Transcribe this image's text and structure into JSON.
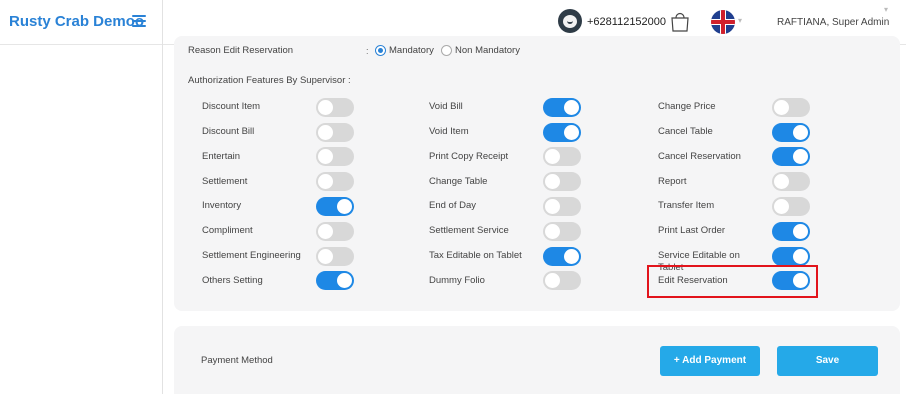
{
  "header": {
    "brand": "Rusty Crab Demoo",
    "phone": "+628112152000",
    "user": "RAFTIANA, Super Admin",
    "icons": [
      "menu-icon",
      "support-icon",
      "shopping-bag-icon",
      "uk-flag-icon"
    ]
  },
  "reason_edit": {
    "label": "Reason Edit Reservation",
    "colon": ":",
    "options": [
      {
        "label": "Mandatory",
        "selected": true
      },
      {
        "label": "Non Mandatory",
        "selected": false
      }
    ]
  },
  "auth": {
    "title": "Authorization Features By Supervisor :",
    "features": [
      {
        "label": "Discount Item",
        "on": false
      },
      {
        "label": "Discount Bill",
        "on": false
      },
      {
        "label": "Entertain",
        "on": false
      },
      {
        "label": "Settlement",
        "on": false
      },
      {
        "label": "Inventory",
        "on": true
      },
      {
        "label": "Compliment",
        "on": false
      },
      {
        "label": "Settlement Engineering",
        "on": false
      },
      {
        "label": "Others Setting",
        "on": true
      },
      {
        "label": "Void Bill",
        "on": true
      },
      {
        "label": "Void Item",
        "on": true
      },
      {
        "label": "Print Copy Receipt",
        "on": false
      },
      {
        "label": "Change Table",
        "on": false
      },
      {
        "label": "End of Day",
        "on": false
      },
      {
        "label": "Settlement Service",
        "on": false
      },
      {
        "label": "Tax Editable on Tablet",
        "on": true
      },
      {
        "label": "Dummy Folio",
        "on": false
      },
      {
        "label": "Change Price",
        "on": false
      },
      {
        "label": "Cancel Table",
        "on": true
      },
      {
        "label": "Cancel Reservation",
        "on": true
      },
      {
        "label": "Report",
        "on": false
      },
      {
        "label": "Transfer Item",
        "on": false
      },
      {
        "label": "Print Last Order",
        "on": true
      },
      {
        "label": "Service Editable on Tablet",
        "on": true
      },
      {
        "label": "Edit Reservation",
        "on": true
      }
    ]
  },
  "payment": {
    "label": "Payment Method",
    "add_button": "+ Add Payment",
    "save_button": "Save"
  },
  "colors": {
    "brand": "#2a82d6",
    "toggle_on": "#1e88e5",
    "toggle_off": "#d8d8d8",
    "button": "#25a9e8",
    "highlight": "#e2141c"
  }
}
